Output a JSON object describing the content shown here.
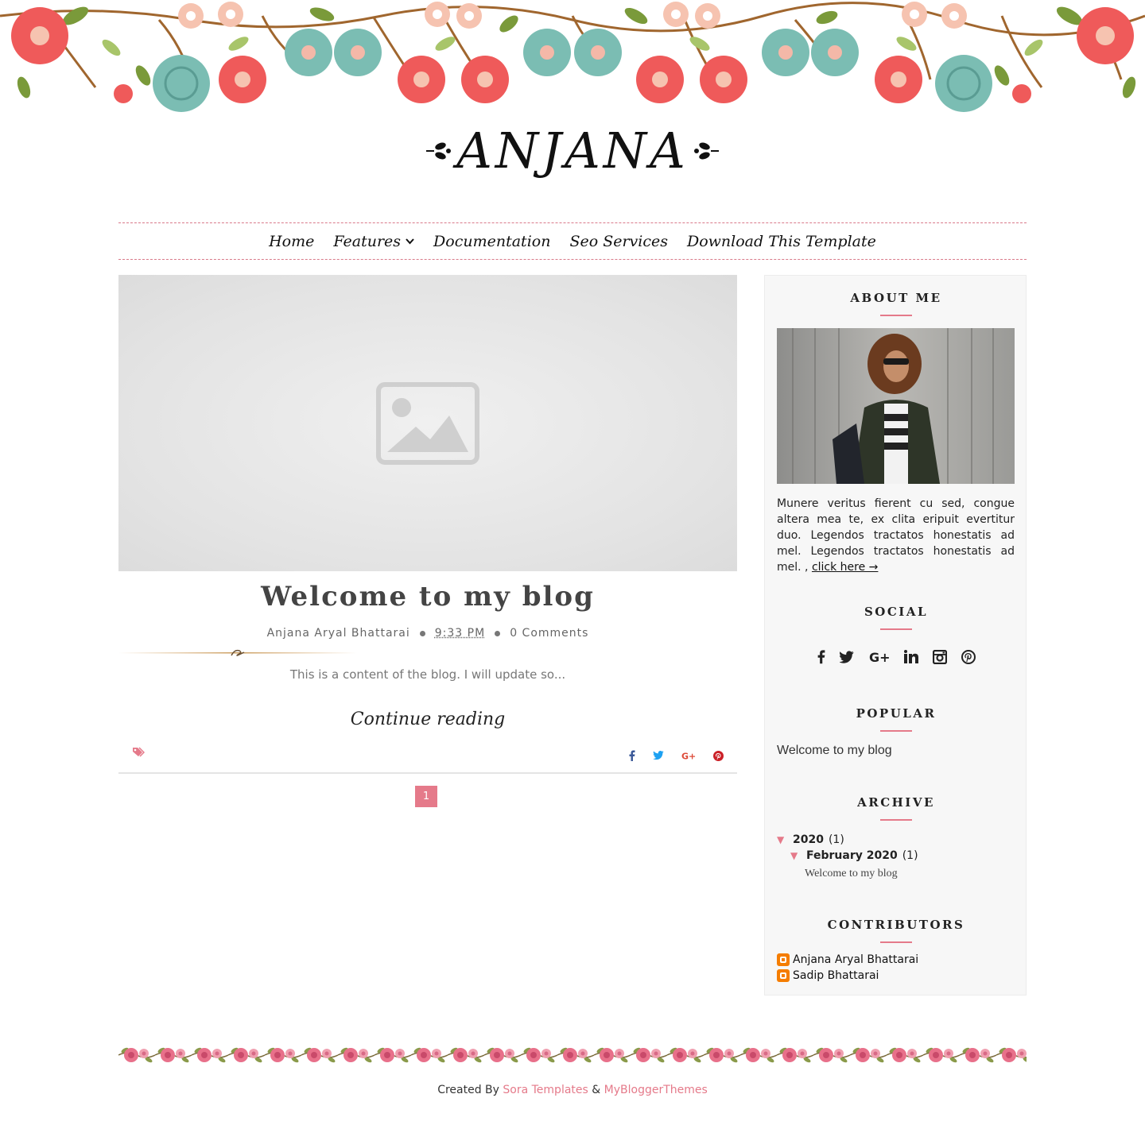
{
  "site": {
    "title": "ANJANA"
  },
  "nav": {
    "items": [
      {
        "label": "Home"
      },
      {
        "label": "Features",
        "has_dropdown": true
      },
      {
        "label": "Documentation"
      },
      {
        "label": "Seo Services"
      },
      {
        "label": "Download This Template"
      }
    ]
  },
  "post": {
    "title": "Welcome to my blog",
    "author": "Anjana Aryal Bhattarai",
    "time": "9:33 PM",
    "comments": "0 Comments",
    "snippet": "This is a content of the blog. I will update so...",
    "continue_label": "Continue reading",
    "share_icons": [
      "facebook-icon",
      "twitter-icon",
      "google-plus-icon",
      "pinterest-icon"
    ]
  },
  "pagination": {
    "current": "1"
  },
  "sidebar": {
    "about": {
      "title": "ABOUT ME",
      "text": "Munere veritus fierent cu sed, congue altera mea te, ex clita eripuit evertitur duo. Legendos tractatos honestatis ad mel. Legendos tractatos honestatis ad mel. , ",
      "link_label": "click here →"
    },
    "social": {
      "title": "SOCIAL",
      "icons": [
        "facebook-icon",
        "twitter-icon",
        "google-plus-icon",
        "linkedin-icon",
        "instagram-icon",
        "pinterest-icon"
      ]
    },
    "popular": {
      "title": "POPULAR",
      "item": "Welcome to my blog"
    },
    "archive": {
      "title": "ARCHIVE",
      "year": "2020",
      "year_count": "(1)",
      "month": "February 2020",
      "month_count": "(1)",
      "post": "Welcome to my blog",
      "toggle": "▼"
    },
    "contributors": {
      "title": "CONTRIBUTORS",
      "names": [
        "Anjana Aryal Bhattarai",
        "Sadip Bhattarai"
      ]
    }
  },
  "footer": {
    "created_by": "Created By ",
    "link1": "Sora Templates",
    "amp": " & ",
    "link2": "MyBloggerThemes"
  },
  "colors": {
    "accent": "#e57a8a",
    "sidebar_bg": "#f7f7f7",
    "blogger_orange": "#f57d00"
  }
}
